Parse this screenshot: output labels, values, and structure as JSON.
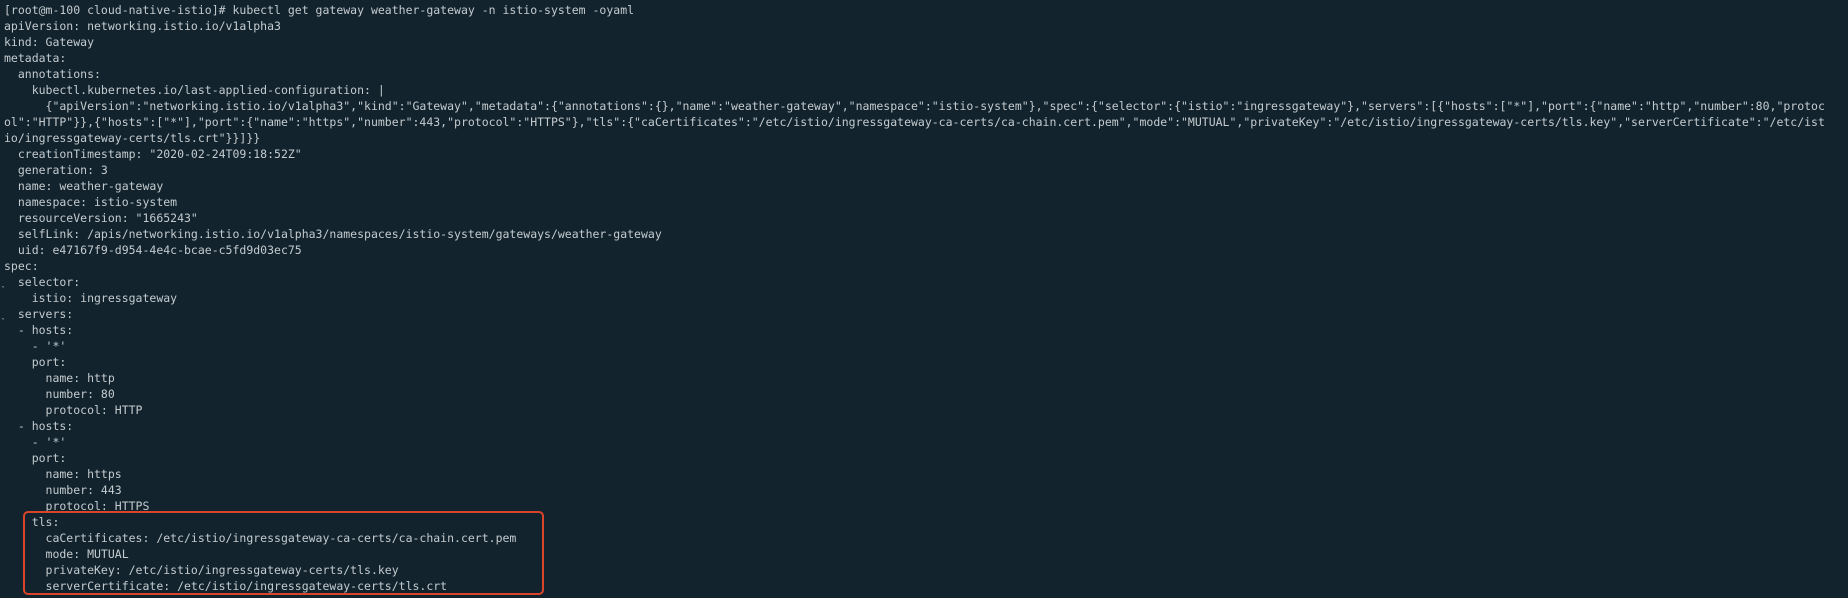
{
  "terminal": {
    "accent_color": "#d9442a",
    "background_color": "#13232d",
    "text_color": "#c3cbcf",
    "lines": [
      "[root@m-100 cloud-native-istio]# kubectl get gateway weather-gateway -n istio-system -oyaml",
      "apiVersion: networking.istio.io/v1alpha3",
      "kind: Gateway",
      "metadata:",
      "  annotations:",
      "    kubectl.kubernetes.io/last-applied-configuration: |",
      "      {\"apiVersion\":\"networking.istio.io/v1alpha3\",\"kind\":\"Gateway\",\"metadata\":{\"annotations\":{},\"name\":\"weather-gateway\",\"namespace\":\"istio-system\"},\"spec\":{\"selector\":{\"istio\":\"ingressgateway\"},\"servers\":[{\"hosts\":[\"*\"],\"port\":{\"name\":\"http\",\"number\":80,\"protoc",
      "ol\":\"HTTP\"}},{\"hosts\":[\"*\"],\"port\":{\"name\":\"https\",\"number\":443,\"protocol\":\"HTTPS\"},\"tls\":{\"caCertificates\":\"/etc/istio/ingressgateway-ca-certs/ca-chain.cert.pem\",\"mode\":\"MUTUAL\",\"privateKey\":\"/etc/istio/ingressgateway-certs/tls.key\",\"serverCertificate\":\"/etc/ist",
      "io/ingressgateway-certs/tls.crt\"}}]}}",
      "  creationTimestamp: \"2020-02-24T09:18:52Z\"",
      "  generation: 3",
      "  name: weather-gateway",
      "  namespace: istio-system",
      "  resourceVersion: \"1665243\"",
      "  selfLink: /apis/networking.istio.io/v1alpha3/namespaces/istio-system/gateways/weather-gateway",
      "  uid: e47167f9-d954-4e4c-bcae-c5fd9d03ec75",
      "spec:",
      "  selector:",
      "    istio: ingressgateway",
      "  servers:",
      "  - hosts:",
      "    - '*'",
      "    port:",
      "      name: http",
      "      number: 80",
      "      protocol: HTTP",
      "  - hosts:",
      "    - '*'",
      "    port:",
      "      name: https",
      "      number: 443",
      "      protocol: HTTPS",
      "    tls:",
      "      caCertificates: /etc/istio/ingressgateway-ca-certs/ca-chain.cert.pem",
      "      mode: MUTUAL",
      "      privateKey: /etc/istio/ingressgateway-certs/tls.key",
      "      serverCertificate: /etc/istio/ingressgateway-certs/tls.crt"
    ]
  }
}
